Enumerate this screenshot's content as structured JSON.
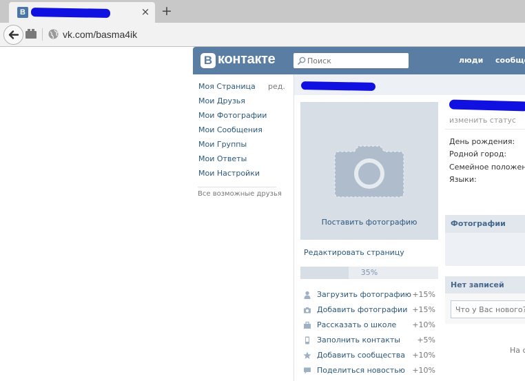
{
  "browser": {
    "tab": {
      "favicon_letter": "B",
      "close_glyph": "×"
    },
    "new_tab_glyph": "+",
    "url": "vk.com/basma4ik"
  },
  "header": {
    "logo_letter": "В",
    "logo_text": "контакте",
    "search_placeholder": "Поиск",
    "nav": [
      "люди",
      "сообще"
    ]
  },
  "left_menu": {
    "items": [
      "Моя Страница",
      "Мои Друзья",
      "Мои Фотографии",
      "Мои Сообщения",
      "Мои Группы",
      "Мои Ответы",
      "Мои Настройки"
    ],
    "edit_label": "ред.",
    "possible_friends": "Все возможные друзья"
  },
  "profile": {
    "avatar_caption": "Поставить фотографию",
    "edit_page": "Редактировать страницу",
    "progress": {
      "value": 35,
      "label": "35%"
    },
    "tasks": [
      {
        "icon": "user-icon",
        "label": "Загрузить фотографию",
        "pct": "+15%"
      },
      {
        "icon": "camera-icon",
        "label": "Добавить фотографии",
        "pct": "+15%"
      },
      {
        "icon": "briefcase-icon",
        "label": "Рассказать о школе",
        "pct": "+10%"
      },
      {
        "icon": "phone-icon",
        "label": "Заполнить контакты",
        "pct": "+5%"
      },
      {
        "icon": "star-icon",
        "label": "Добавить сообщества",
        "pct": "+10%"
      },
      {
        "icon": "speech-bubble-icon",
        "label": "Поделиться новостью",
        "pct": "+10%"
      }
    ]
  },
  "info": {
    "change_status": "изменить статус",
    "fields": [
      "День рождения:",
      "Родной город:",
      "Семейное положение:",
      "Языки:"
    ],
    "photos_header": "Фотографии",
    "posts_header": "Нет записей",
    "post_placeholder": "Что у Вас нового?",
    "na_text": "На с"
  },
  "colors": {
    "vk_blue": "#597da3",
    "link": "#2b587a",
    "redaction": "#1010e0"
  }
}
